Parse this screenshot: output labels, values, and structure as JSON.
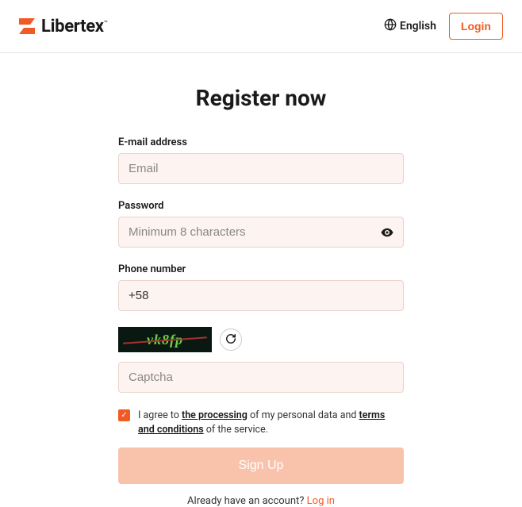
{
  "header": {
    "brand": "Libertex",
    "trademark": "™",
    "language": "English",
    "login_label": "Login"
  },
  "form": {
    "title": "Register now",
    "email_label": "E-mail address",
    "email_placeholder": "Email",
    "password_label": "Password",
    "password_placeholder": "Minimum 8 characters",
    "phone_label": "Phone number",
    "phone_value": "+58",
    "captcha_text": "vk8fp",
    "captcha_placeholder": "Captcha",
    "consent_prefix": "I agree to ",
    "consent_link1": "the processing",
    "consent_mid": " of my personal data and ",
    "consent_link2": "terms and conditions",
    "consent_suffix": " of the service.",
    "consent_checked": true,
    "signup_label": "Sign Up",
    "already_text": "Already have an account? ",
    "already_link": "Log in"
  }
}
